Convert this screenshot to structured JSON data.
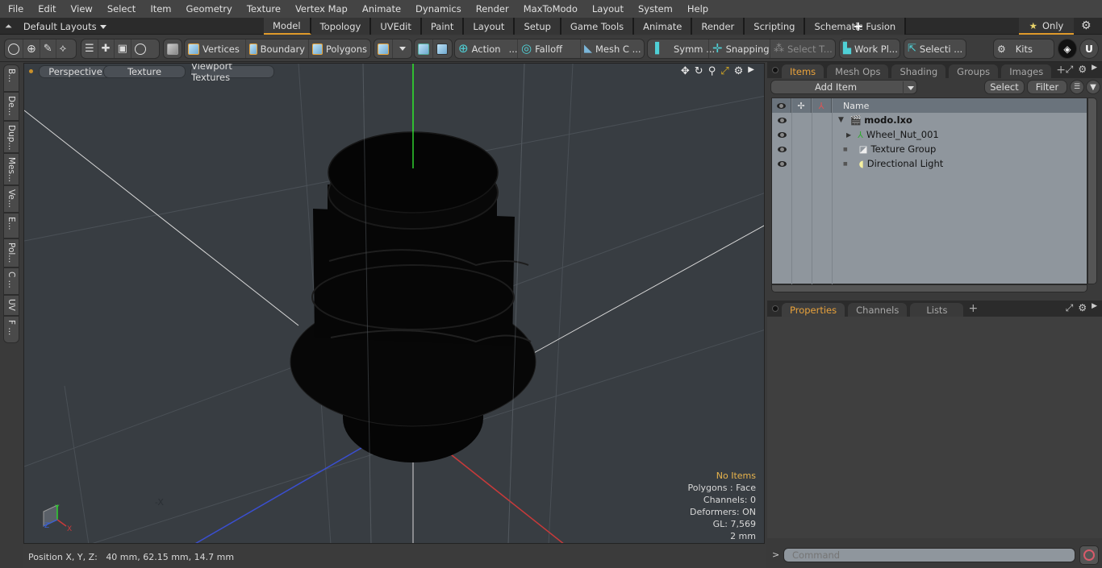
{
  "menu": [
    "File",
    "Edit",
    "View",
    "Select",
    "Item",
    "Geometry",
    "Texture",
    "Vertex Map",
    "Animate",
    "Dynamics",
    "Render",
    "MaxToModo",
    "Layout",
    "System",
    "Help"
  ],
  "layout_bar": {
    "layouts_label": "Default Layouts",
    "tabs": [
      "Model",
      "Topology",
      "UVEdit",
      "Paint",
      "Layout",
      "Setup",
      "Game Tools",
      "Animate",
      "Render",
      "Scripting",
      "Schematic Fusion"
    ],
    "active_tab": "Model",
    "only_label": "Only"
  },
  "toolbar": {
    "vertices": "Vertices",
    "boundary": "Boundary",
    "polygons": "Polygons",
    "action": "Action",
    "falloff": "Falloff",
    "mesh_c": "Mesh C ...",
    "symm": "Symm ...",
    "snapping": "Snapping",
    "select_t": "Select T...",
    "work_pl": "Work Pl...",
    "selecti": "Selecti ...",
    "kits": "Kits",
    "ellipsis": "..."
  },
  "left_tabs": [
    "B...",
    "De...",
    "Dup...",
    "Mes...",
    "Ve...",
    "E...",
    "Pol...",
    "C ...",
    "UV",
    "F ..."
  ],
  "viewport": {
    "view_mode": "Perspective",
    "shading": "Texture",
    "textures": "Viewport Textures",
    "info": {
      "selection": "No Items",
      "polygons": "Polygons : Face",
      "channels": "Channels: 0",
      "deformers": "Deformers: ON",
      "gl": "GL: 7,569",
      "scale": "2 mm"
    },
    "axis_labels": {
      "x": "X",
      "y": "Y",
      "z": "Z",
      "neg_x": "-X"
    },
    "colors": {
      "x_axis": "#c83a3a",
      "y_axis": "#2fcf2f",
      "z_axis": "#3a4fd0",
      "selection": "#e9b44c"
    }
  },
  "status": {
    "label": "Position X, Y, Z:",
    "value": "40 mm, 62.15 mm, 14.7 mm"
  },
  "items_panel": {
    "tabs": [
      "Items",
      "Mesh Ops",
      "Shading",
      "Groups",
      "Images"
    ],
    "active_tab": "Items",
    "add_item": "Add Item",
    "select": "Select",
    "filter": "Filter",
    "column_name": "Name",
    "items": [
      {
        "name": "modo.lxo",
        "icon": "scene-clapper-icon",
        "bold": true
      },
      {
        "name": "Wheel_Nut_001",
        "icon": "mesh-locator-icon",
        "bold": false
      },
      {
        "name": "Texture Group",
        "icon": "texture-group-icon",
        "bold": false
      },
      {
        "name": "Directional Light",
        "icon": "directional-light-icon",
        "bold": false
      }
    ]
  },
  "props_panel": {
    "tabs": [
      "Properties",
      "Channels",
      "Lists"
    ],
    "active_tab": "Properties"
  },
  "command": {
    "placeholder": "Command",
    "prompt": ">"
  },
  "accent_color": "#e09a2a"
}
